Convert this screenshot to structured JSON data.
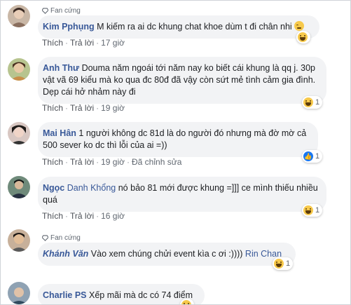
{
  "fan_badge": "Fan cứng",
  "actions": {
    "like": "Thích",
    "reply": "Trả lời",
    "edited": "Đã chỉnh sửa"
  },
  "comments": [
    {
      "name": "Kim Pphụng",
      "text": "M kiếm ra ai dc khung chat khoe dùm t đi chân nhi",
      "time": "17 giờ",
      "reaction": "haha",
      "reaction_count": ""
    },
    {
      "name": "Anh Thư",
      "text": "Douma năm ngoái tới năm nay ko biết cái khung là qq j. 30p vật vã 69 kiểu mà ko qua đc 80đ đã vậy còn sứt mẻ tình cảm gia đình. Dẹp cái hở nhảm này đi",
      "time": "19 giờ",
      "reaction": "haha",
      "reaction_count": "1"
    },
    {
      "name": "Mai Hân",
      "text": "1 người không dc 81d là do người đó nhưng mà đờ mờ cả 500 sever ko dc thì lỗi của ai =))",
      "time": "19 giờ",
      "reaction": "like",
      "reaction_count": "1"
    },
    {
      "name": "Ngọc",
      "name_extra": "Danh Khổng",
      "text": "nó bảo 81 mới được khung =]]] ce mình thiếu nhiều quá",
      "time": "16 giờ",
      "reaction": "haha",
      "reaction_count": "1"
    },
    {
      "name": "Khánh Văn",
      "text": "Vào xem chúng chửi event kìa c ơi :))))",
      "mention": "Rin Chan",
      "reaction": "haha",
      "reaction_count": "1"
    },
    {
      "name": "Charlie PS",
      "text": "Xếp mãi mà dc có 74 điểm"
    }
  ],
  "colors": {
    "link": "#385898",
    "bubble": "#f2f3f5",
    "meta": "#606770"
  }
}
